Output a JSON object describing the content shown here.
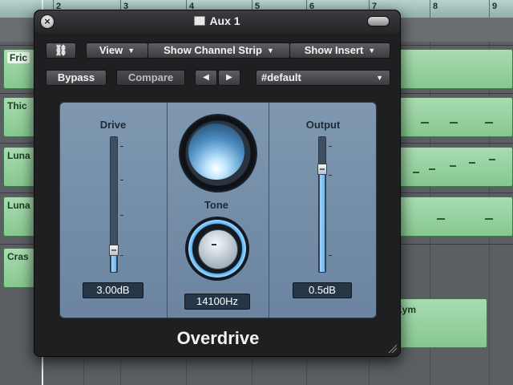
{
  "arrange": {
    "ruler_numbers": [
      "2",
      "3",
      "4",
      "5",
      "6",
      "7",
      "8",
      "9"
    ],
    "tracks": [
      {
        "region_label": "Fric",
        "selected": true
      },
      {
        "region_label": "Thic",
        "selected": false
      },
      {
        "region_label": "Luna",
        "selected": false
      },
      {
        "region_label": "Luna",
        "selected": false
      },
      {
        "region_label": "Cras",
        "selected": false
      }
    ],
    "extra_region_label": "Kym",
    "colors": {
      "region": "#8fcd98",
      "ruler": "#a8c8c3"
    }
  },
  "plugin_window": {
    "title": "Aux 1",
    "close_label": "×",
    "toolbar": {
      "link_label": "⛓",
      "view_label": "View",
      "channel_strip_label": "Show Channel Strip",
      "insert_label": "Show Insert",
      "bypass_label": "Bypass",
      "compare_label": "Compare",
      "prev_label": "◀",
      "next_label": "▶",
      "preset_value": "#default"
    },
    "drive": {
      "label": "Drive",
      "value_text": "3.00dB",
      "level": 0.12
    },
    "tone": {
      "label": "Tone",
      "value_text": "14100Hz"
    },
    "output": {
      "label": "Output",
      "value_text": "0.5dB",
      "level": 0.72
    },
    "plugin_name": "Overdrive",
    "colors": {
      "panel": "#7790a9",
      "window": "#1e1f21",
      "meter": "#8fcaf5"
    }
  }
}
